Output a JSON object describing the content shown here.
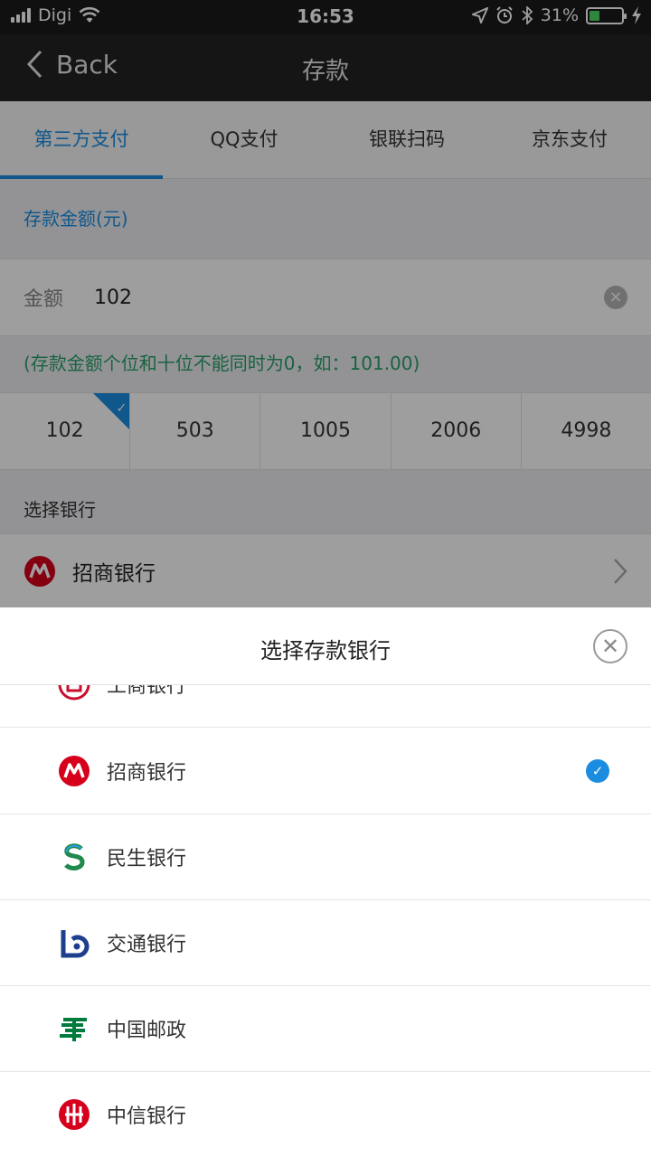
{
  "status_bar": {
    "carrier": "Digi",
    "time": "16:53",
    "battery": "31%",
    "battery_level": 0.31
  },
  "nav": {
    "back_label": "Back",
    "title": "存款"
  },
  "tabs": [
    {
      "label": "第三方支付",
      "active": true
    },
    {
      "label": "QQ支付",
      "active": false
    },
    {
      "label": "银联扫码",
      "active": false
    },
    {
      "label": "京东支付",
      "active": false
    }
  ],
  "deposit": {
    "section_label": "存款金额(元)",
    "amount_label": "金额",
    "amount_value": "102",
    "hint": "(存款金额个位和十位不能同时为0，如：101.00)",
    "presets": [
      "102",
      "503",
      "1005",
      "2006",
      "4998"
    ],
    "selected_preset": "102"
  },
  "bank_select": {
    "label": "选择银行",
    "selected_bank": "招商银行"
  },
  "sheet": {
    "title": "选择存款银行",
    "banks": [
      {
        "name": "工商银行",
        "icon": "icbc-logo-icon",
        "color": "#c8102e"
      },
      {
        "name": "招商银行",
        "icon": "cmb-logo-icon",
        "color": "#d6001c",
        "selected": true
      },
      {
        "name": "民生银行",
        "icon": "cmbc-logo-icon",
        "color": "#1f8a4c"
      },
      {
        "name": "交通银行",
        "icon": "bocom-logo-icon",
        "color": "#1e3f8e"
      },
      {
        "name": "中国邮政",
        "icon": "psbc-logo-icon",
        "color": "#007a3d"
      },
      {
        "name": "中信银行",
        "icon": "citic-logo-icon",
        "color": "#d6001c"
      }
    ]
  },
  "colors": {
    "accent": "#1a8de0",
    "hint_green": "#29a06a"
  }
}
